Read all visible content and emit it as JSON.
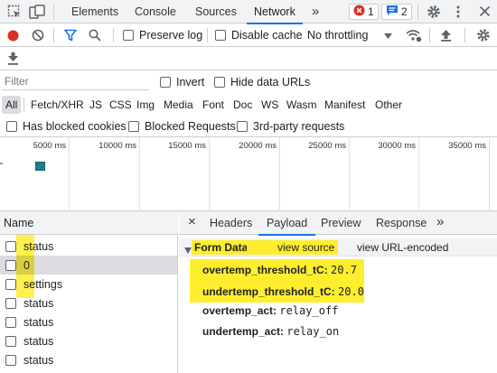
{
  "devtools": {
    "tabs": [
      "Elements",
      "Console",
      "Sources",
      "Network"
    ],
    "active_tab": "Network",
    "more_tabs_glyph": "»",
    "errors_count": "1",
    "messages_count": "2",
    "icons": [
      "inspect-icon",
      "device-toggle-icon",
      "gear-icon",
      "kebab-menu-icon",
      "close-icon"
    ]
  },
  "toolbar": {
    "preserve_log": "Preserve log",
    "disable_cache": "Disable cache",
    "throttling": "No throttling",
    "icons": [
      "record-icon",
      "clear-icon",
      "filter-icon",
      "search-icon",
      "network-conditions-icon",
      "import-har-icon",
      "settings-icon",
      "export-har-icon"
    ]
  },
  "filter": {
    "placeholder": "Filter",
    "invert": "Invert",
    "hide_data_urls": "Hide data URLs"
  },
  "types": [
    "All",
    "Fetch/XHR",
    "JS",
    "CSS",
    "Img",
    "Media",
    "Font",
    "Doc",
    "WS",
    "Wasm",
    "Manifest",
    "Other"
  ],
  "blocking": {
    "has_blocked_cookies": "Has blocked cookies",
    "blocked_requests": "Blocked Requests",
    "third_party": "3rd-party requests"
  },
  "overview": {
    "ticks": [
      "5000 ms",
      "10000 ms",
      "15000 ms",
      "20000 ms",
      "25000 ms",
      "30000 ms",
      "35000 ms"
    ],
    "bar_color": "#1a7f8e"
  },
  "requests": {
    "header": "Name",
    "rows": [
      "status",
      "0",
      "settings",
      "status",
      "status",
      "status",
      "status"
    ],
    "selected_index": 1
  },
  "details": {
    "close_glyph": "×",
    "tabs": [
      "Headers",
      "Payload",
      "Preview",
      "Response"
    ],
    "active_tab": "Payload",
    "more_glyph": "»",
    "section_title": "Form Data",
    "view_source": "view source",
    "view_url_encoded": "view URL-encoded",
    "fields": [
      {
        "key": "overtemp_threshold_tC:",
        "value": "20.7"
      },
      {
        "key": "undertemp_threshold_tC:",
        "value": "20.0"
      },
      {
        "key": "overtemp_act:",
        "value": "relay_off"
      },
      {
        "key": "undertemp_act:",
        "value": "relay_on"
      }
    ]
  },
  "colors": {
    "accent": "#1a73e8",
    "record": "#d93025",
    "error": "#d93025",
    "highlight": "#ffee2e"
  }
}
